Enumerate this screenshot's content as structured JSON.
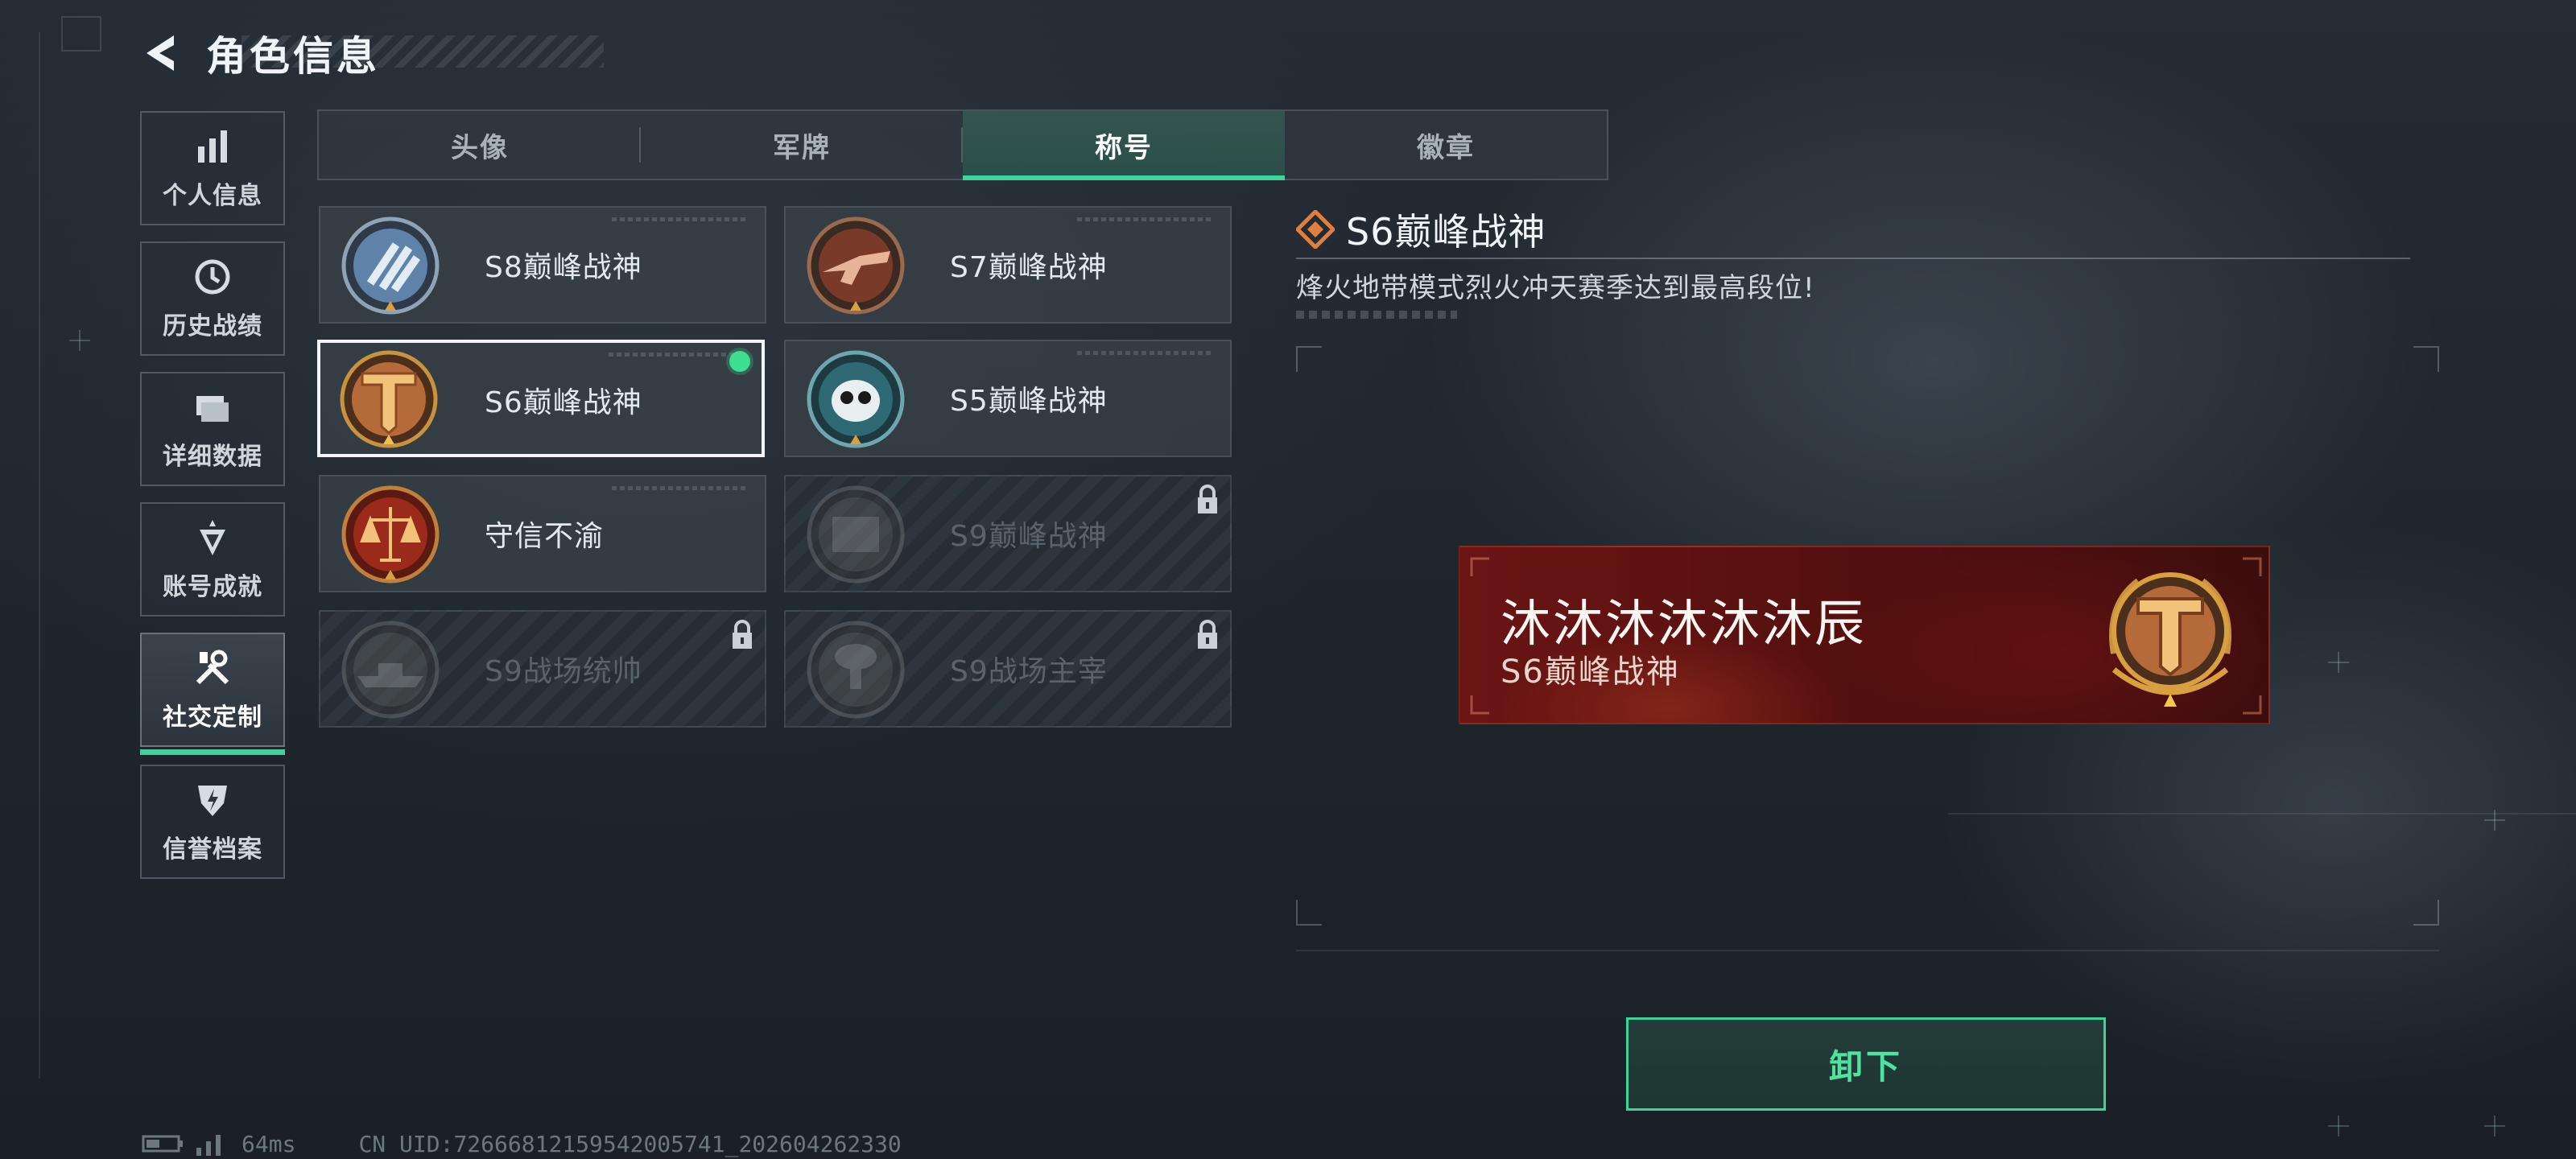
{
  "header": {
    "title": "角色信息",
    "back_icon": "back-arrow-icon"
  },
  "sidebar": {
    "items": [
      {
        "label": "个人信息",
        "icon": "bar-chart-icon",
        "active": false
      },
      {
        "label": "历史战绩",
        "icon": "history-icon",
        "active": false
      },
      {
        "label": "详细数据",
        "icon": "folder-icon",
        "active": false
      },
      {
        "label": "账号成就",
        "icon": "achievement-icon",
        "active": false
      },
      {
        "label": "社交定制",
        "icon": "tools-icon",
        "active": true
      },
      {
        "label": "信誉档案",
        "icon": "shield-bolt-icon",
        "active": false
      }
    ]
  },
  "tabs": [
    {
      "label": "头像",
      "active": false
    },
    {
      "label": "军牌",
      "active": false
    },
    {
      "label": "称号",
      "active": true
    },
    {
      "label": "徽章",
      "active": false
    }
  ],
  "titles": [
    {
      "name": "S8巅峰战神",
      "locked": false,
      "selected": false,
      "emblem": "s8-emblem-icon"
    },
    {
      "name": "S7巅峰战神",
      "locked": false,
      "selected": false,
      "emblem": "s7-emblem-icon"
    },
    {
      "name": "S6巅峰战神",
      "locked": false,
      "selected": true,
      "equipped": true,
      "emblem": "s6-emblem-icon"
    },
    {
      "name": "S5巅峰战神",
      "locked": false,
      "selected": false,
      "emblem": "s5-emblem-icon"
    },
    {
      "name": "守信不渝",
      "locked": false,
      "selected": false,
      "emblem": "scales-emblem-icon"
    },
    {
      "name": "S9巅峰战神",
      "locked": true,
      "selected": false,
      "emblem": "s9-emblem-icon"
    },
    {
      "name": "S9战场统帅",
      "locked": true,
      "selected": false,
      "emblem": "warship-emblem-icon"
    },
    {
      "name": "S9战场主宰",
      "locked": true,
      "selected": false,
      "emblem": "mushroom-cloud-emblem-icon"
    }
  ],
  "detail": {
    "title": "S6巅峰战神",
    "description": "烽火地带模式烈火冲天赛季达到最高段位!"
  },
  "nameplate": {
    "player": "沐沐沐沐沐沐辰",
    "title": "S6巅峰战神"
  },
  "unequip_label": "卸下",
  "status": {
    "ping": "64ms",
    "uid": "CN UID:72666812159542005741_202604262330"
  },
  "colors": {
    "accent": "#3cd49a",
    "plate_red": "#5a1212",
    "gold": "#d9a040"
  }
}
